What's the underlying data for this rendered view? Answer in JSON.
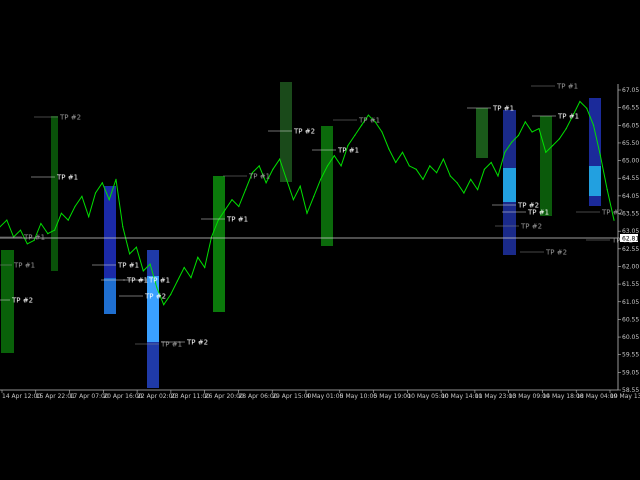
{
  "chart_data": {
    "type": "line",
    "title": "",
    "xlabel": "",
    "ylabel": "",
    "grid": false,
    "x_ticks": [
      "14 Apr 12:00",
      "15 Apr 22:01",
      "17 Apr 07:00",
      "20 Apr 16:00",
      "22 Apr 02:00",
      "23 Apr 11:00",
      "26 Apr 20:00",
      "28 Apr 06:00",
      "29 Apr 15:00",
      "4 May 01:00",
      "5 May 10:00",
      "5 May 19:00",
      "10 May 05:00",
      "10 May 14:00",
      "11 May 23:00",
      "13 May 09:00",
      "14 May 18:00",
      "18 May 04:00",
      "19 May 13:00"
    ],
    "y_ticks": [
      "67.05",
      "66.55",
      "66.05",
      "65.50",
      "65.00",
      "64.55",
      "64.05",
      "63.55",
      "63.05",
      "62.55",
      "62.00",
      "61.55",
      "61.05",
      "60.55",
      "60.05",
      "59.55",
      "59.05",
      "58.55"
    ],
    "ylim": [
      58.5,
      67.3
    ],
    "current_price": "62.81",
    "series": [
      {
        "color": "#00e000",
        "x": [
          0,
          2,
          4,
          6,
          8,
          10,
          12,
          14,
          16,
          18,
          20,
          22,
          24,
          26,
          28,
          30,
          32,
          34,
          36,
          38,
          40,
          42,
          44,
          46,
          48,
          50,
          52,
          54,
          56,
          58,
          60,
          62,
          64,
          66,
          68,
          70,
          72,
          74,
          76,
          78,
          80,
          82,
          84,
          86,
          88,
          90,
          92,
          94,
          96,
          98,
          100,
          102,
          104,
          106,
          108,
          110,
          112,
          114,
          116,
          118,
          120,
          122,
          124,
          126,
          128,
          130,
          132,
          134,
          136,
          138,
          140,
          142,
          144,
          146,
          148,
          150,
          152,
          154,
          156,
          158,
          160,
          162,
          164,
          166,
          168,
          170,
          172,
          174,
          176,
          178,
          180
        ],
        "y": [
          63.2,
          63.4,
          62.9,
          63.1,
          62.7,
          62.8,
          63.3,
          63.0,
          63.1,
          63.6,
          63.4,
          63.8,
          64.1,
          63.5,
          64.2,
          64.5,
          64.0,
          64.6,
          63.2,
          62.4,
          62.6,
          61.9,
          62.1,
          61.4,
          60.9,
          61.2,
          61.6,
          62.0,
          61.7,
          62.3,
          62.0,
          62.9,
          63.4,
          63.7,
          64.0,
          63.8,
          64.3,
          64.8,
          65.0,
          64.5,
          64.9,
          65.2,
          64.6,
          64.0,
          64.4,
          63.6,
          64.1,
          64.6,
          65.0,
          65.3,
          65.0,
          65.6,
          65.9,
          66.2,
          66.5,
          66.3,
          66.0,
          65.5,
          65.1,
          65.4,
          65.0,
          64.9,
          64.6,
          65.0,
          64.8,
          65.2,
          64.7,
          64.5,
          64.2,
          64.6,
          64.3,
          64.9,
          65.1,
          64.7,
          65.4,
          65.7,
          65.9,
          66.3,
          66.0,
          66.1,
          65.4,
          65.6,
          65.8,
          66.1,
          66.5,
          66.9,
          66.7,
          66.2,
          65.3,
          64.3,
          63.4
        ]
      }
    ],
    "annotations": [
      {
        "text": "TP #2"
      },
      {
        "text": "TP #1"
      },
      {
        "text": "TP #1"
      },
      {
        "text": "TP #1"
      },
      {
        "text": "TP #2"
      },
      {
        "text": "TP #1"
      },
      {
        "text": "TP #1"
      },
      {
        "text": "TP #2"
      },
      {
        "text": "TP #1"
      },
      {
        "text": "TP #1"
      },
      {
        "text": "TP #2"
      },
      {
        "text": "TP #1"
      },
      {
        "text": "TP #1"
      },
      {
        "text": "TP #2"
      },
      {
        "text": "TP #1"
      },
      {
        "text": "TP #1"
      },
      {
        "text": "TP #1"
      },
      {
        "text": "TP #2"
      },
      {
        "text": "TP #2"
      },
      {
        "text": "TP #1"
      },
      {
        "text": "TP #2"
      },
      {
        "text": "TP #1"
      },
      {
        "text": "TP #1"
      },
      {
        "text": "TP #2"
      },
      {
        "text": "TP #2"
      }
    ]
  }
}
